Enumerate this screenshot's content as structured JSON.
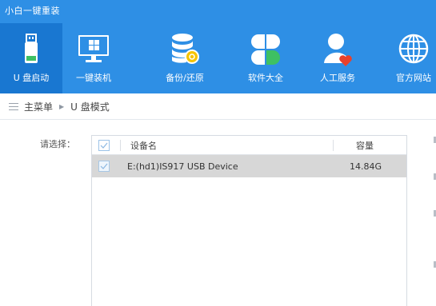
{
  "app": {
    "title": "小白一键重装"
  },
  "nav": {
    "items": [
      {
        "label": "U 盘启动",
        "icon": "usb-drive-icon"
      },
      {
        "label": "一键装机",
        "icon": "windows-monitor-icon"
      },
      {
        "label": "备份/还原",
        "icon": "database-backup-icon"
      },
      {
        "label": "软件大全",
        "icon": "clover-apps-icon"
      },
      {
        "label": "人工服务",
        "icon": "user-heart-icon"
      },
      {
        "label": "官方网站",
        "icon": "globe-icon"
      }
    ],
    "active_index": 0
  },
  "breadcrumb": {
    "root": "主菜单",
    "current": "U 盘模式"
  },
  "main": {
    "select_label": "请选择：",
    "table": {
      "columns": {
        "name": "设备名",
        "size": "容量"
      },
      "rows": [
        {
          "name": "E:(hd1)IS917 USB Device",
          "size": "14.84G",
          "selected": true
        }
      ]
    }
  },
  "colors": {
    "header_bg": "#2e8fe5",
    "active_tab_bg": "#1977d1",
    "selected_row_bg": "#d7d7d7"
  }
}
